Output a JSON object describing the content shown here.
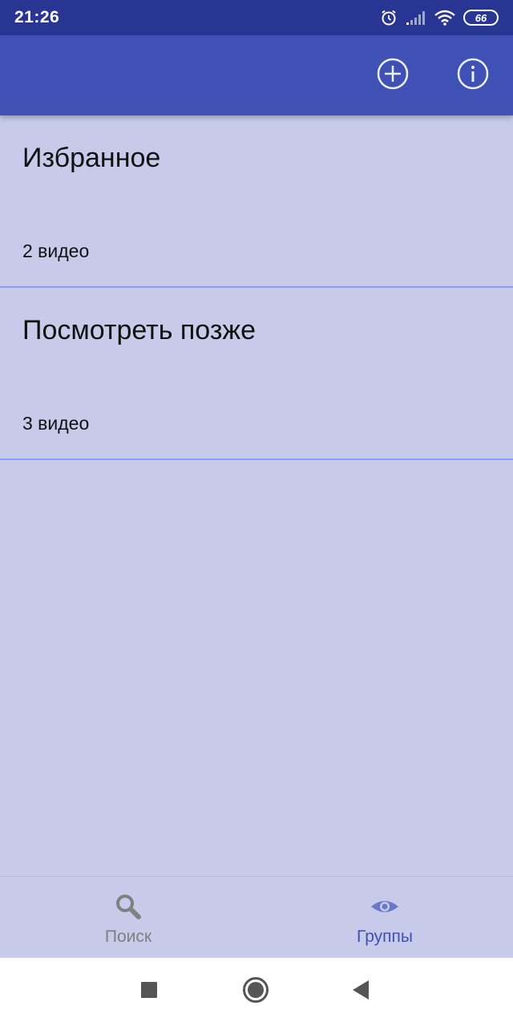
{
  "status_bar": {
    "time": "21:26",
    "battery": "66",
    "icons": [
      "alarm-icon",
      "signal-icon",
      "wifi-icon",
      "battery-icon"
    ]
  },
  "app_bar": {
    "actions": [
      "add-circle-icon",
      "info-icon"
    ],
    "color": "#3f51b5"
  },
  "groups": [
    {
      "title": "Избранное",
      "count": "2 видео"
    },
    {
      "title": "Посмотреть позже",
      "count": "3 видео"
    }
  ],
  "bottom_nav": {
    "tabs": [
      {
        "label": "Поиск",
        "icon": "search-icon",
        "active": false
      },
      {
        "label": "Группы",
        "icon": "eye-icon",
        "active": true
      }
    ]
  },
  "system_nav": {
    "buttons": [
      "recents-square-icon",
      "home-circle-icon",
      "back-triangle-icon"
    ]
  },
  "colors": {
    "status_bar": "#283593",
    "background": "#c7cae9",
    "divider": "#8a9bff",
    "active_tab": "#3f51b5",
    "inactive_tab": "#808080"
  }
}
